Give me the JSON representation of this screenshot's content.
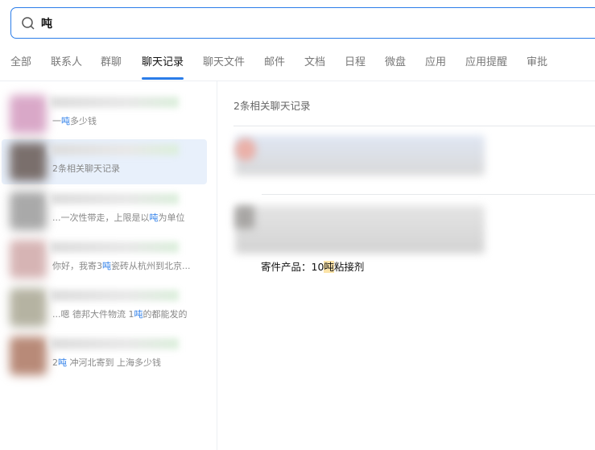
{
  "search": {
    "query": "吨"
  },
  "tabs": [
    {
      "label": "全部"
    },
    {
      "label": "联系人"
    },
    {
      "label": "群聊"
    },
    {
      "label": "聊天记录",
      "active": true
    },
    {
      "label": "聊天文件"
    },
    {
      "label": "邮件"
    },
    {
      "label": "文档"
    },
    {
      "label": "日程"
    },
    {
      "label": "微盘"
    },
    {
      "label": "应用"
    },
    {
      "label": "应用提醒"
    },
    {
      "label": "审批"
    }
  ],
  "results": [
    {
      "pre": "一",
      "hl": "吨",
      "post": "多少钱"
    },
    {
      "pre": "2条相关聊天记录",
      "hl": "",
      "post": "",
      "selected": true
    },
    {
      "pre": "...一次性带走，上限是以",
      "hl": "吨",
      "post": "为单位"
    },
    {
      "pre": "你好，我寄3",
      "hl": "吨",
      "post": "瓷砖从杭州到北京..."
    },
    {
      "pre": "...嗯 德邦大件物流 1",
      "hl": "吨",
      "post": "的都能发的"
    },
    {
      "pre": "2",
      "hl": "吨",
      "post": " 冲河北寄到 上海多少钱"
    }
  ],
  "detail": {
    "title": "2条相关聊天记录",
    "message": {
      "pre": "寄件产品：10",
      "hl": "吨",
      "post": "粘接剂"
    }
  },
  "colors": {
    "accent": "#2b7de9",
    "highlight": "#fbe3a8"
  }
}
